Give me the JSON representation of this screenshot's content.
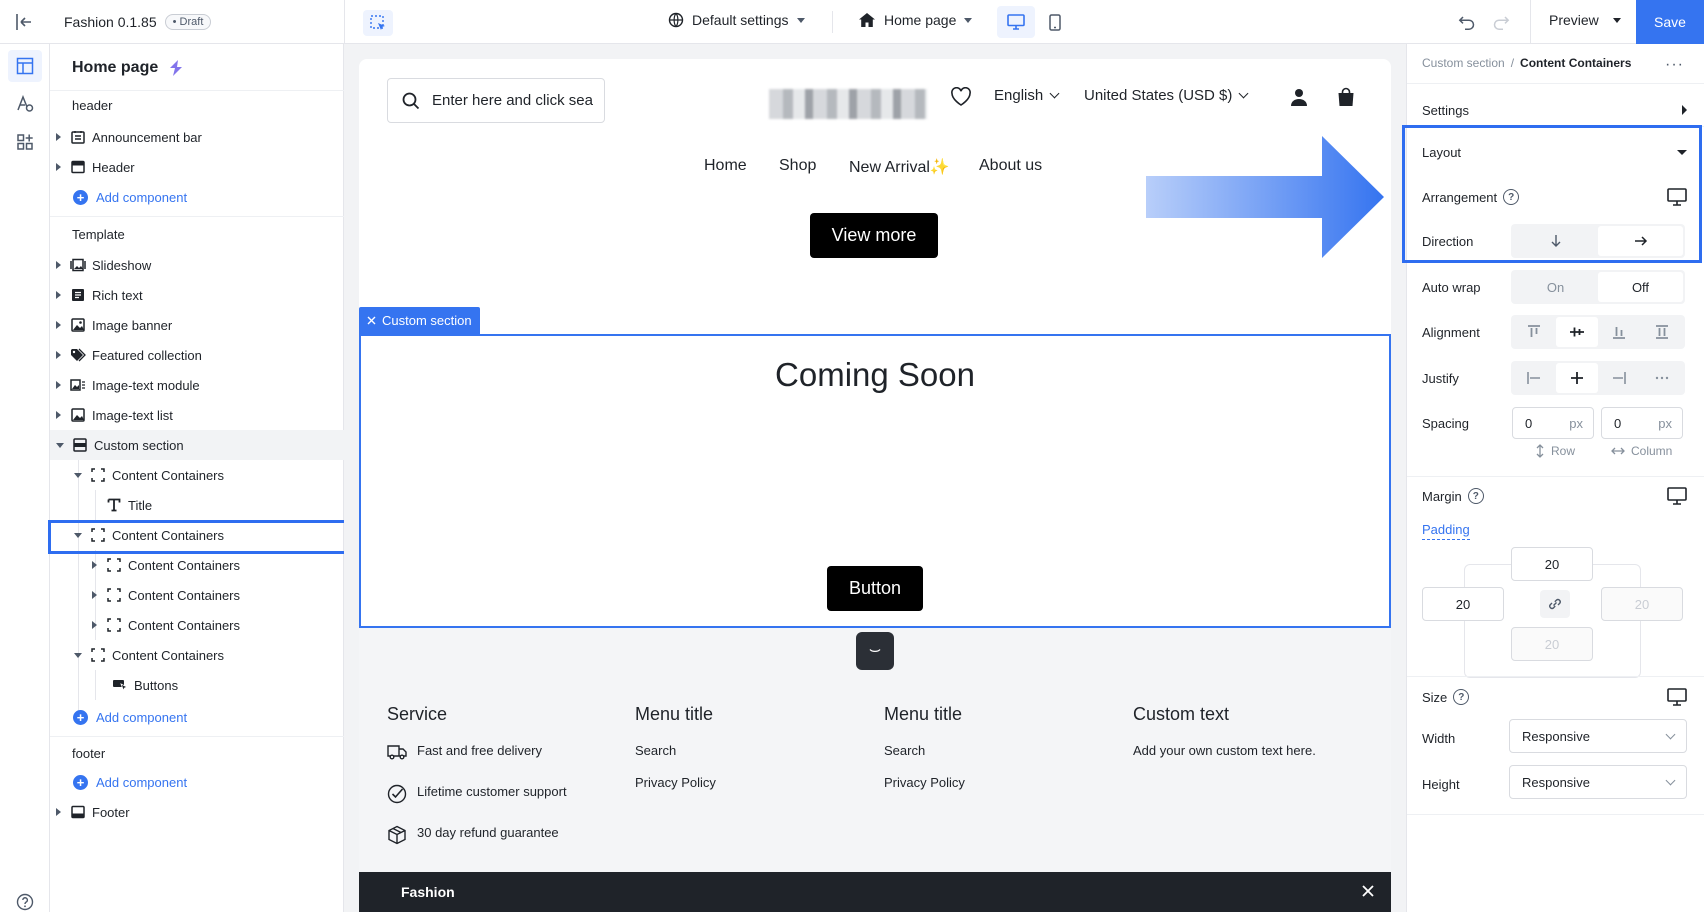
{
  "app": {
    "title": "Fashion 0.1.85",
    "badge": "• Draft"
  },
  "toolbar": {
    "theme_settings": "Default settings",
    "page_select": "Home page",
    "preview": "Preview",
    "save": "Save"
  },
  "tree": {
    "title": "Home page",
    "header_group": "header",
    "header_items": [
      "Announcement bar",
      "Header"
    ],
    "add_component": "Add component",
    "template_group": "Template",
    "template_items": [
      "Slideshow",
      "Rich text",
      "Image banner",
      "Featured collection",
      "Image-text module",
      "Image-text list",
      "Custom section"
    ],
    "custom_children": {
      "container_a": "Content Containers",
      "title": "Title",
      "container_b": "Content Containers",
      "sub1": "Content Containers",
      "sub2": "Content Containers",
      "sub3": "Content Containers",
      "container_c": "Content Containers",
      "buttons": "Buttons"
    },
    "footer_group": "footer",
    "footer_items": [
      "Footer"
    ]
  },
  "canvas": {
    "search_placeholder": "Enter here and click sea",
    "language": "English",
    "currency": "United States (USD $)",
    "nav": [
      "Home",
      "Shop",
      "New Arrival✨",
      "About us"
    ],
    "view_more": "View more",
    "section_tag": "Custom section",
    "heading": "Coming Soon",
    "button": "Button",
    "footer_cols": [
      {
        "title": "Service",
        "items": [
          "Fast and free delivery",
          "Lifetime customer support",
          "30 day refund guarantee"
        ]
      },
      {
        "title": "Menu title",
        "items": [
          "Search",
          "Privacy Policy"
        ]
      },
      {
        "title": "Menu title",
        "items": [
          "Search",
          "Privacy Policy"
        ]
      },
      {
        "title": "Custom text",
        "items": [
          "Add your own custom text here."
        ]
      }
    ],
    "bottom_bar": "Fashion"
  },
  "panel": {
    "crumb_parent": "Custom section",
    "crumb_sep": "/",
    "crumb_current": "Content Containers",
    "settings": "Settings",
    "layout": "Layout",
    "arrangement": "Arrangement",
    "direction": "Direction",
    "auto_wrap": "Auto wrap",
    "on": "On",
    "off": "Off",
    "alignment": "Alignment",
    "justify": "Justify",
    "spacing": "Spacing",
    "spacing_row_value": "0",
    "spacing_col_value": "0",
    "unit": "px",
    "row": "Row",
    "column": "Column",
    "margin": "Margin",
    "padding": "Padding",
    "pad_top": "20",
    "pad_left": "20",
    "pad_right": "20",
    "pad_bottom": "20",
    "size": "Size",
    "width": "Width",
    "width_value": "Responsive",
    "height": "Height",
    "height_value": "Responsive"
  },
  "colors": {
    "accent": "#3574f0",
    "highlight": "#2e6df0",
    "canvas_bg": "#f2f3f5"
  }
}
